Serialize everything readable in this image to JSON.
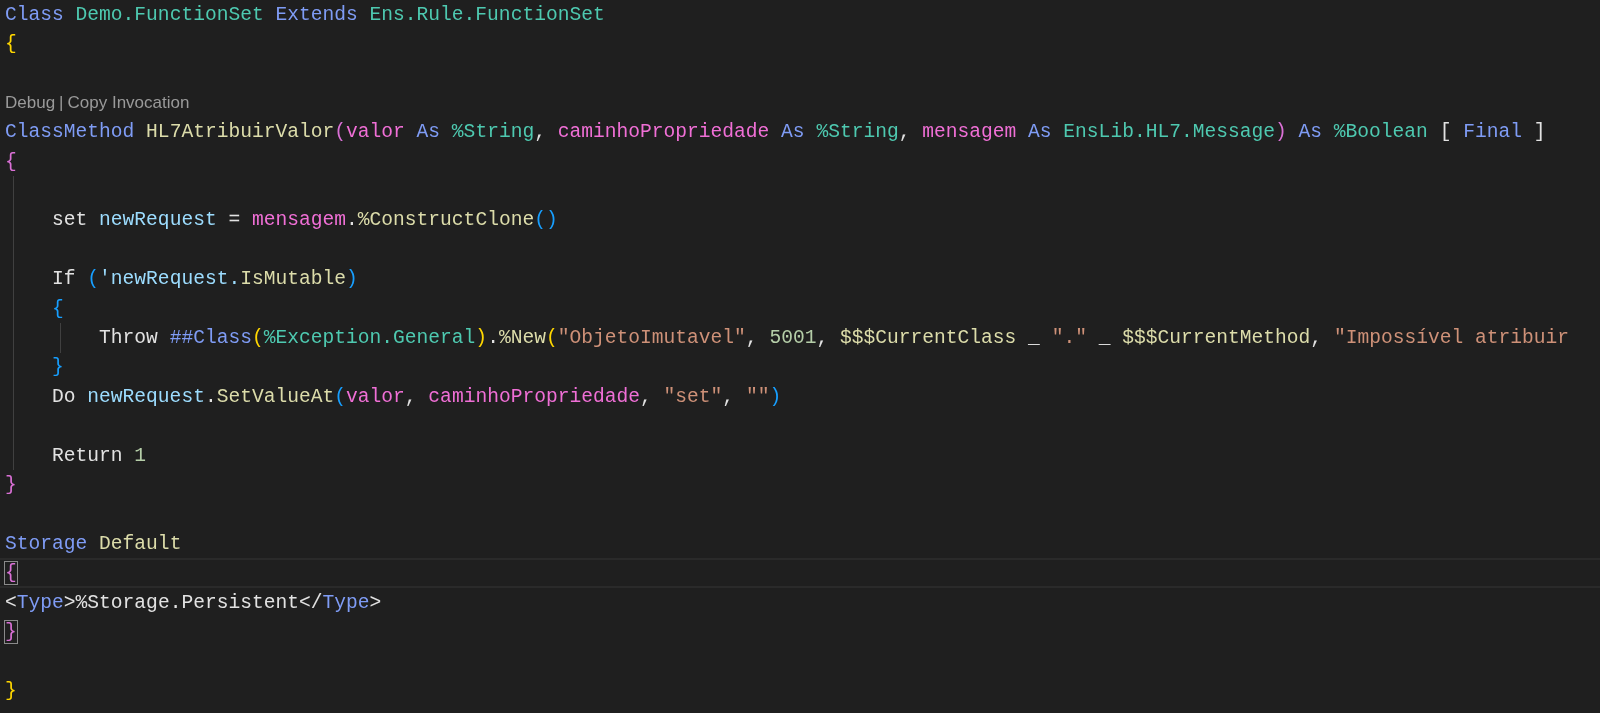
{
  "editor": {
    "lines": [
      {
        "kind": "code",
        "current": false,
        "tokens": [
          {
            "text": "Class ",
            "kind": "kw"
          },
          {
            "text": "Demo.FunctionSet ",
            "kind": "type"
          },
          {
            "text": "Extends ",
            "kind": "kw"
          },
          {
            "text": "Ens.Rule.FunctionSet",
            "kind": "type"
          }
        ]
      },
      {
        "kind": "code",
        "current": false,
        "tokens": [
          {
            "text": "{",
            "kind": "br1"
          }
        ]
      },
      {
        "kind": "blank"
      },
      {
        "kind": "codelens",
        "links": [
          "Debug",
          "Copy Invocation"
        ],
        "separator": "|"
      },
      {
        "kind": "code",
        "current": false,
        "tokens": [
          {
            "text": "ClassMethod ",
            "kind": "kw"
          },
          {
            "text": "HL7AtribuirValor",
            "kind": "func"
          },
          {
            "text": "(",
            "kind": "br2"
          },
          {
            "text": "valor ",
            "kind": "param"
          },
          {
            "text": "As ",
            "kind": "kw"
          },
          {
            "text": "%String",
            "kind": "type"
          },
          {
            "text": ", ",
            "kind": "plain"
          },
          {
            "text": "caminhoPropriedade ",
            "kind": "param"
          },
          {
            "text": "As ",
            "kind": "kw"
          },
          {
            "text": "%String",
            "kind": "type"
          },
          {
            "text": ", ",
            "kind": "plain"
          },
          {
            "text": "mensagem ",
            "kind": "param"
          },
          {
            "text": "As ",
            "kind": "kw"
          },
          {
            "text": "EnsLib.HL7.Message",
            "kind": "type"
          },
          {
            "text": ")",
            "kind": "br2"
          },
          {
            "text": " As ",
            "kind": "kw"
          },
          {
            "text": "%Boolean ",
            "kind": "type"
          },
          {
            "text": "[ ",
            "kind": "plain"
          },
          {
            "text": "Final ",
            "kind": "kw"
          },
          {
            "text": "]",
            "kind": "plain"
          }
        ]
      },
      {
        "kind": "code",
        "current": false,
        "tokens": [
          {
            "text": "{",
            "kind": "br2"
          }
        ]
      },
      {
        "kind": "block",
        "lines": [
          {
            "kind": "blank"
          },
          {
            "kind": "code",
            "current": false,
            "tokens": [
              {
                "text": "set ",
                "kind": "plain"
              },
              {
                "text": "newRequest ",
                "kind": "var"
              },
              {
                "text": "= ",
                "kind": "plain"
              },
              {
                "text": "mensagem",
                "kind": "param"
              },
              {
                "text": ".",
                "kind": "plain"
              },
              {
                "text": "%ConstructClone",
                "kind": "func"
              },
              {
                "text": "()",
                "kind": "br3"
              }
            ]
          },
          {
            "kind": "blank"
          },
          {
            "kind": "code",
            "current": false,
            "tokens": [
              {
                "text": "If ",
                "kind": "plain"
              },
              {
                "text": "(",
                "kind": "br3"
              },
              {
                "text": "'newRequest.",
                "kind": "var"
              },
              {
                "text": "IsMutable",
                "kind": "func"
              },
              {
                "text": ")",
                "kind": "br3"
              }
            ]
          },
          {
            "kind": "code",
            "current": false,
            "tokens": [
              {
                "text": "{",
                "kind": "br3"
              }
            ]
          },
          {
            "kind": "block",
            "lines": [
              {
                "kind": "code",
                "current": false,
                "tokens": [
                  {
                    "text": "Throw ",
                    "kind": "plain"
                  },
                  {
                    "text": "##Class",
                    "kind": "kw"
                  },
                  {
                    "text": "(",
                    "kind": "br1"
                  },
                  {
                    "text": "%Exception.General",
                    "kind": "type"
                  },
                  {
                    "text": ")",
                    "kind": "br1"
                  },
                  {
                    "text": ".",
                    "kind": "plain"
                  },
                  {
                    "text": "%New",
                    "kind": "func"
                  },
                  {
                    "text": "(",
                    "kind": "br1"
                  },
                  {
                    "text": "\"ObjetoImutavel\"",
                    "kind": "str"
                  },
                  {
                    "text": ", ",
                    "kind": "plain"
                  },
                  {
                    "text": "5001",
                    "kind": "num"
                  },
                  {
                    "text": ", ",
                    "kind": "plain"
                  },
                  {
                    "text": "$$$CurrentClass ",
                    "kind": "func"
                  },
                  {
                    "text": "_ ",
                    "kind": "plain"
                  },
                  {
                    "text": "\".\" ",
                    "kind": "str"
                  },
                  {
                    "text": "_ ",
                    "kind": "plain"
                  },
                  {
                    "text": "$$$CurrentMethod",
                    "kind": "func"
                  },
                  {
                    "text": ", ",
                    "kind": "plain"
                  },
                  {
                    "text": "\"Impossível atribuir",
                    "kind": "str"
                  }
                ]
              }
            ]
          },
          {
            "kind": "code",
            "current": false,
            "tokens": [
              {
                "text": "}",
                "kind": "br3"
              }
            ]
          },
          {
            "kind": "code",
            "current": false,
            "tokens": [
              {
                "text": "Do ",
                "kind": "plain"
              },
              {
                "text": "newRequest",
                "kind": "var"
              },
              {
                "text": ".",
                "kind": "plain"
              },
              {
                "text": "SetValueAt",
                "kind": "func"
              },
              {
                "text": "(",
                "kind": "br3"
              },
              {
                "text": "valor",
                "kind": "param"
              },
              {
                "text": ", ",
                "kind": "plain"
              },
              {
                "text": "caminhoPropriedade",
                "kind": "param"
              },
              {
                "text": ", ",
                "kind": "plain"
              },
              {
                "text": "\"set\"",
                "kind": "str"
              },
              {
                "text": ", ",
                "kind": "plain"
              },
              {
                "text": "\"\"",
                "kind": "str"
              },
              {
                "text": ")",
                "kind": "br3"
              }
            ]
          },
          {
            "kind": "blank"
          },
          {
            "kind": "code",
            "current": false,
            "tokens": [
              {
                "text": "Return ",
                "kind": "plain"
              },
              {
                "text": "1",
                "kind": "num"
              }
            ]
          }
        ]
      },
      {
        "kind": "code",
        "current": false,
        "tokens": [
          {
            "text": "}",
            "kind": "br2"
          }
        ]
      },
      {
        "kind": "blank"
      },
      {
        "kind": "code",
        "current": false,
        "tokens": [
          {
            "text": "Storage ",
            "kind": "kw"
          },
          {
            "text": "Default",
            "kind": "func"
          }
        ]
      },
      {
        "kind": "code",
        "current": true,
        "tokens": [
          {
            "text": "{",
            "kind": "br2",
            "matched": true
          }
        ]
      },
      {
        "kind": "code",
        "current": false,
        "tokens": [
          {
            "text": "<",
            "kind": "plain"
          },
          {
            "text": "Type",
            "kind": "kw"
          },
          {
            "text": ">%Storage.Persistent</",
            "kind": "plain"
          },
          {
            "text": "Type",
            "kind": "kw"
          },
          {
            "text": ">",
            "kind": "plain"
          }
        ]
      },
      {
        "kind": "code",
        "current": false,
        "tokens": [
          {
            "text": "}",
            "kind": "br2",
            "matched": true
          }
        ]
      },
      {
        "kind": "blank"
      },
      {
        "kind": "code",
        "current": false,
        "tokens": [
          {
            "text": "}",
            "kind": "br1"
          }
        ]
      }
    ]
  }
}
